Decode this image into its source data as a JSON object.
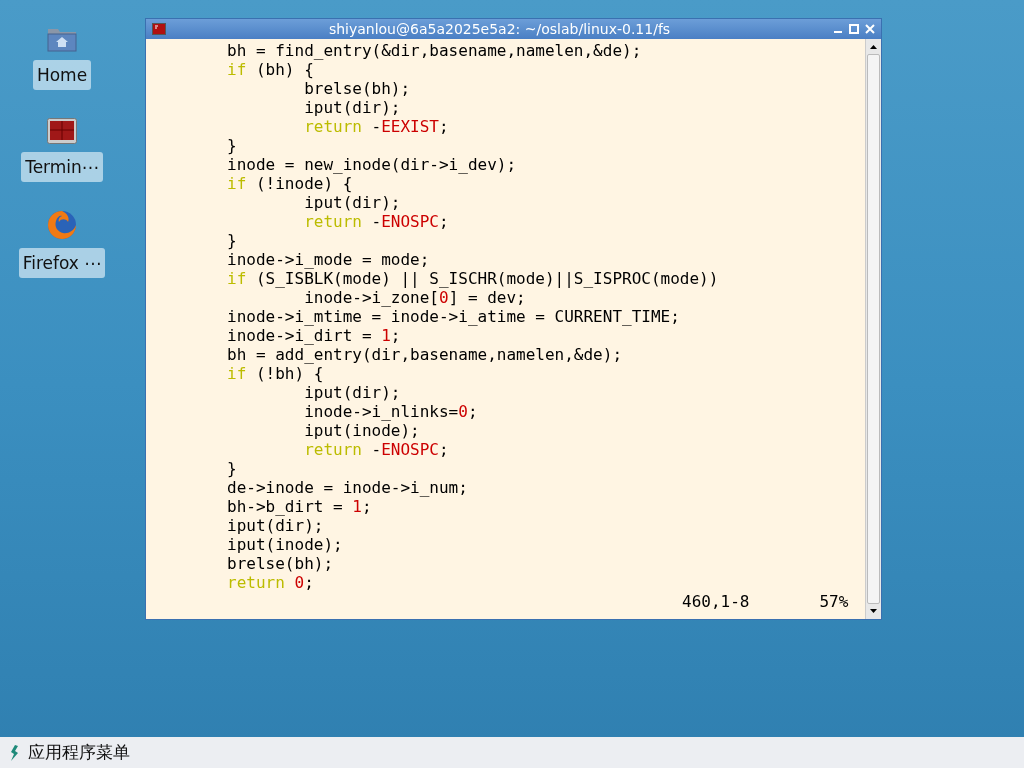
{
  "desktop_icons": [
    {
      "kind": "folder",
      "label": "Home",
      "selected": true
    },
    {
      "kind": "terminal",
      "label": "Termin⋯",
      "selected": true
    },
    {
      "kind": "browser",
      "label": "Firefox ⋯",
      "selected": true
    }
  ],
  "window": {
    "title": "shiyanlou@6a5a2025e5a2: ~/oslab/linux-0.11/fs",
    "code_lines": [
      [
        {
          "kind": "plain",
          "text": "        bh = find_entry(&dir,basename,namelen,&de);"
        }
      ],
      [
        {
          "kind": "keyword",
          "text": "        if"
        },
        {
          "kind": "plain",
          "text": " (bh) {"
        }
      ],
      [
        {
          "kind": "plain",
          "text": "                brelse(bh);"
        }
      ],
      [
        {
          "kind": "plain",
          "text": "                iput(dir);"
        }
      ],
      [
        {
          "kind": "keyword",
          "text": "                return"
        },
        {
          "kind": "plain",
          "text": " -"
        },
        {
          "kind": "constant",
          "text": "EEXIST"
        },
        {
          "kind": "plain",
          "text": ";"
        }
      ],
      [
        {
          "kind": "plain",
          "text": "        }"
        }
      ],
      [
        {
          "kind": "plain",
          "text": "        inode = new_inode(dir->i_dev);"
        }
      ],
      [
        {
          "kind": "keyword",
          "text": "        if"
        },
        {
          "kind": "plain",
          "text": " (!inode) {"
        }
      ],
      [
        {
          "kind": "plain",
          "text": "                iput(dir);"
        }
      ],
      [
        {
          "kind": "keyword",
          "text": "                return"
        },
        {
          "kind": "plain",
          "text": " -"
        },
        {
          "kind": "constant",
          "text": "ENOSPC"
        },
        {
          "kind": "plain",
          "text": ";"
        }
      ],
      [
        {
          "kind": "plain",
          "text": "        }"
        }
      ],
      [
        {
          "kind": "plain",
          "text": "        inode->i_mode = mode;"
        }
      ],
      [
        {
          "kind": "keyword",
          "text": "        if"
        },
        {
          "kind": "plain",
          "text": " (S_ISBLK(mode) || S_ISCHR(mode)||S_ISPROC(mode))"
        }
      ],
      [
        {
          "kind": "plain",
          "text": "                inode->i_zone["
        },
        {
          "kind": "constant",
          "text": "0"
        },
        {
          "kind": "plain",
          "text": "] = dev;"
        }
      ],
      [
        {
          "kind": "plain",
          "text": "        inode->i_mtime = inode->i_atime = CURRENT_TIME;"
        }
      ],
      [
        {
          "kind": "plain",
          "text": "        inode->i_dirt = "
        },
        {
          "kind": "constant",
          "text": "1"
        },
        {
          "kind": "plain",
          "text": ";"
        }
      ],
      [
        {
          "kind": "plain",
          "text": "        bh = add_entry(dir,basename,namelen,&de);"
        }
      ],
      [
        {
          "kind": "keyword",
          "text": "        if"
        },
        {
          "kind": "plain",
          "text": " (!bh) {"
        }
      ],
      [
        {
          "kind": "plain",
          "text": "                iput(dir);"
        }
      ],
      [
        {
          "kind": "plain",
          "text": "                inode->i_nlinks="
        },
        {
          "kind": "constant",
          "text": "0"
        },
        {
          "kind": "plain",
          "text": ";"
        }
      ],
      [
        {
          "kind": "plain",
          "text": "                iput(inode);"
        }
      ],
      [
        {
          "kind": "keyword",
          "text": "                return"
        },
        {
          "kind": "plain",
          "text": " -"
        },
        {
          "kind": "constant",
          "text": "ENOSPC"
        },
        {
          "kind": "plain",
          "text": ";"
        }
      ],
      [
        {
          "kind": "plain",
          "text": "        }"
        }
      ],
      [
        {
          "kind": "plain",
          "text": "        de->inode = inode->i_num;"
        }
      ],
      [
        {
          "kind": "plain",
          "text": "        bh->b_dirt = "
        },
        {
          "kind": "constant",
          "text": "1"
        },
        {
          "kind": "plain",
          "text": ";"
        }
      ],
      [
        {
          "kind": "plain",
          "text": "        iput(dir);"
        }
      ],
      [
        {
          "kind": "plain",
          "text": "        iput(inode);"
        }
      ],
      [
        {
          "kind": "plain",
          "text": "        brelse(bh);"
        }
      ],
      [
        {
          "kind": "keyword",
          "text": "        return"
        },
        {
          "kind": "constant",
          "text": " 0"
        },
        {
          "kind": "plain",
          "text": ";"
        }
      ]
    ],
    "status": {
      "position": "460,1-8",
      "percent": "57%"
    }
  },
  "taskbar": {
    "menu_label": "应用程序菜单"
  }
}
